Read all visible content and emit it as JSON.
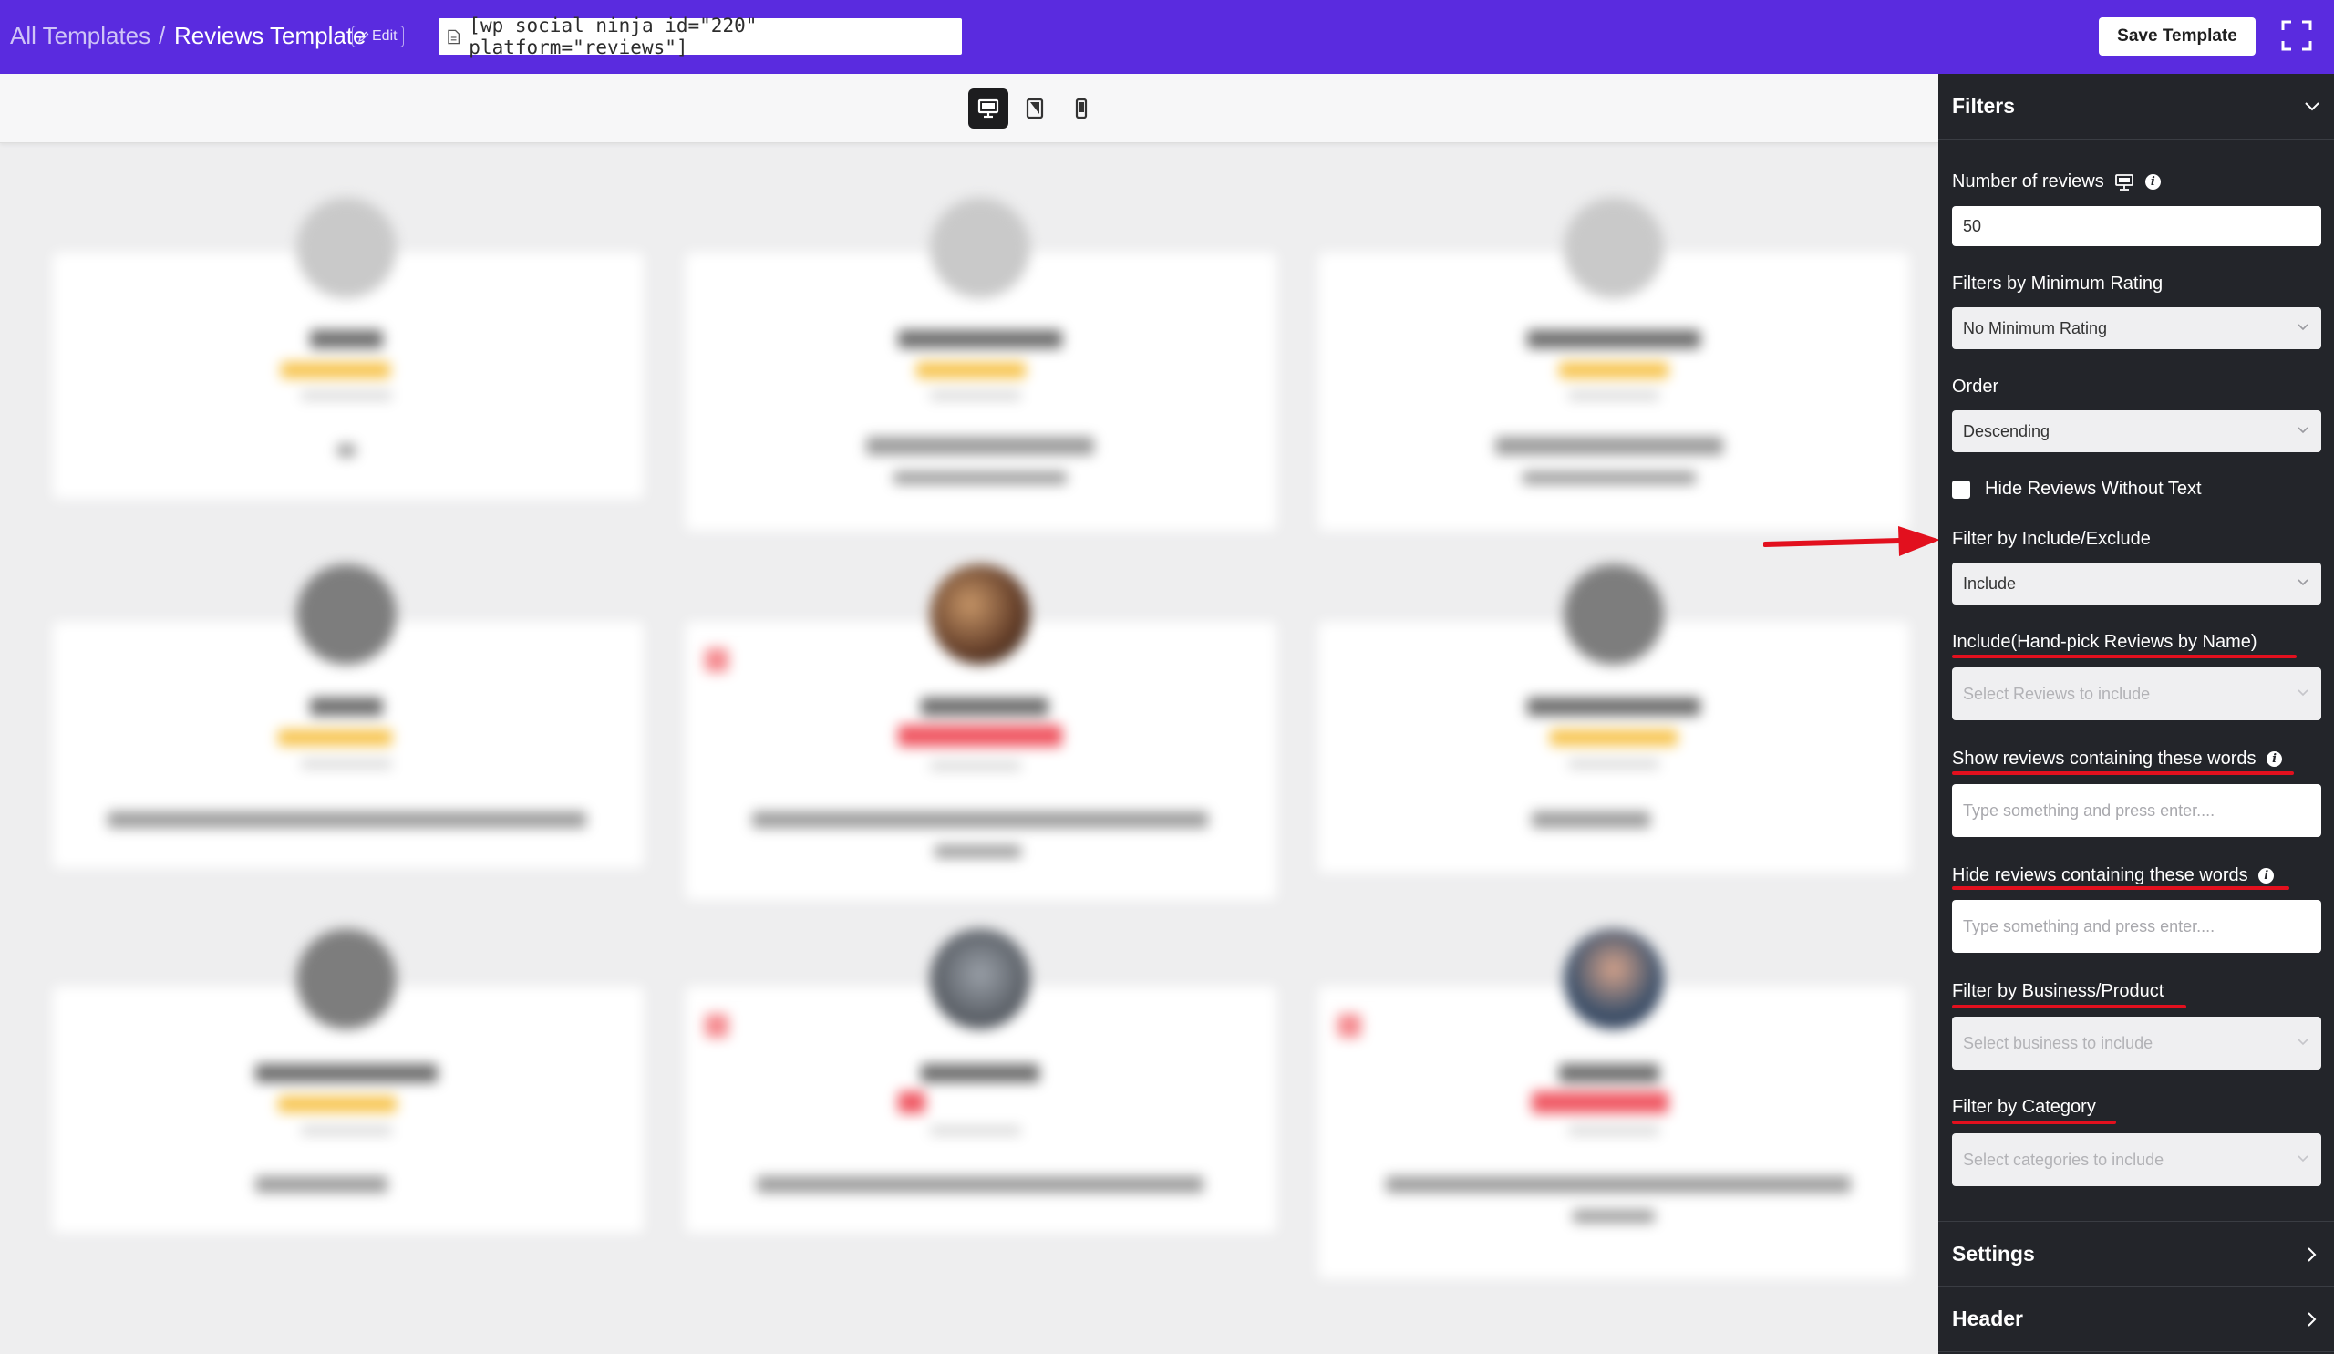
{
  "topbar": {
    "all_templates": "All Templates",
    "separator": "/",
    "current_template": "Reviews Template",
    "edit_label": "Edit",
    "shortcode": "[wp_social_ninja id=\"220\" platform=\"reviews\"]",
    "save_label": "Save Template",
    "bg_color": "#5a2bdf"
  },
  "device_bar": {
    "devices": [
      "desktop-icon",
      "tablet-icon",
      "mobile-icon"
    ],
    "active": "desktop"
  },
  "sidebar": {
    "filters": {
      "title": "Filters",
      "number_of_reviews_label": "Number of reviews",
      "number_of_reviews_value": "50",
      "min_rating_label": "Filters by Minimum Rating",
      "min_rating_value": "No Minimum Rating",
      "order_label": "Order",
      "order_value": "Descending",
      "hide_without_text_label": "Hide Reviews Without Text",
      "hide_without_text_checked": false,
      "include_exclude_label": "Filter by Include/Exclude",
      "include_exclude_value": "Include",
      "handpick_label": "Include(Hand-pick Reviews by Name)",
      "handpick_placeholder": "Select Reviews to include",
      "show_words_label": "Show reviews containing these words",
      "show_words_placeholder": "Type something and press enter....",
      "hide_words_label": "Hide reviews containing these words",
      "hide_words_placeholder": "Type something and press enter....",
      "business_label": "Filter by Business/Product",
      "business_placeholder": "Select business to include",
      "category_label": "Filter by Category",
      "category_placeholder": "Select categories to include"
    },
    "settings_title": "Settings",
    "header_title": "Header"
  },
  "annotation_color": "#e2101e"
}
